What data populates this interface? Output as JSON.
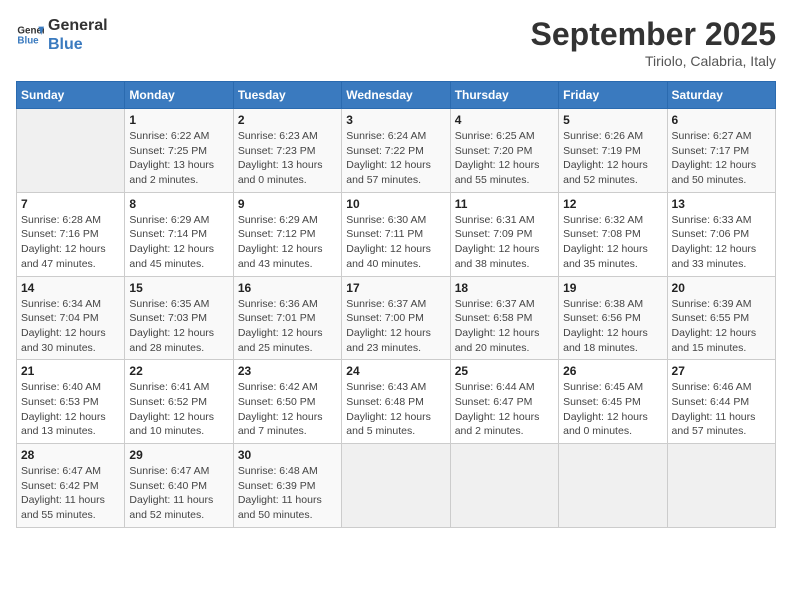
{
  "header": {
    "logo_line1": "General",
    "logo_line2": "Blue",
    "month": "September 2025",
    "location": "Tiriolo, Calabria, Italy"
  },
  "weekdays": [
    "Sunday",
    "Monday",
    "Tuesday",
    "Wednesday",
    "Thursday",
    "Friday",
    "Saturday"
  ],
  "weeks": [
    [
      {
        "num": "",
        "info": ""
      },
      {
        "num": "1",
        "info": "Sunrise: 6:22 AM\nSunset: 7:25 PM\nDaylight: 13 hours\nand 2 minutes."
      },
      {
        "num": "2",
        "info": "Sunrise: 6:23 AM\nSunset: 7:23 PM\nDaylight: 13 hours\nand 0 minutes."
      },
      {
        "num": "3",
        "info": "Sunrise: 6:24 AM\nSunset: 7:22 PM\nDaylight: 12 hours\nand 57 minutes."
      },
      {
        "num": "4",
        "info": "Sunrise: 6:25 AM\nSunset: 7:20 PM\nDaylight: 12 hours\nand 55 minutes."
      },
      {
        "num": "5",
        "info": "Sunrise: 6:26 AM\nSunset: 7:19 PM\nDaylight: 12 hours\nand 52 minutes."
      },
      {
        "num": "6",
        "info": "Sunrise: 6:27 AM\nSunset: 7:17 PM\nDaylight: 12 hours\nand 50 minutes."
      }
    ],
    [
      {
        "num": "7",
        "info": "Sunrise: 6:28 AM\nSunset: 7:16 PM\nDaylight: 12 hours\nand 47 minutes."
      },
      {
        "num": "8",
        "info": "Sunrise: 6:29 AM\nSunset: 7:14 PM\nDaylight: 12 hours\nand 45 minutes."
      },
      {
        "num": "9",
        "info": "Sunrise: 6:29 AM\nSunset: 7:12 PM\nDaylight: 12 hours\nand 43 minutes."
      },
      {
        "num": "10",
        "info": "Sunrise: 6:30 AM\nSunset: 7:11 PM\nDaylight: 12 hours\nand 40 minutes."
      },
      {
        "num": "11",
        "info": "Sunrise: 6:31 AM\nSunset: 7:09 PM\nDaylight: 12 hours\nand 38 minutes."
      },
      {
        "num": "12",
        "info": "Sunrise: 6:32 AM\nSunset: 7:08 PM\nDaylight: 12 hours\nand 35 minutes."
      },
      {
        "num": "13",
        "info": "Sunrise: 6:33 AM\nSunset: 7:06 PM\nDaylight: 12 hours\nand 33 minutes."
      }
    ],
    [
      {
        "num": "14",
        "info": "Sunrise: 6:34 AM\nSunset: 7:04 PM\nDaylight: 12 hours\nand 30 minutes."
      },
      {
        "num": "15",
        "info": "Sunrise: 6:35 AM\nSunset: 7:03 PM\nDaylight: 12 hours\nand 28 minutes."
      },
      {
        "num": "16",
        "info": "Sunrise: 6:36 AM\nSunset: 7:01 PM\nDaylight: 12 hours\nand 25 minutes."
      },
      {
        "num": "17",
        "info": "Sunrise: 6:37 AM\nSunset: 7:00 PM\nDaylight: 12 hours\nand 23 minutes."
      },
      {
        "num": "18",
        "info": "Sunrise: 6:37 AM\nSunset: 6:58 PM\nDaylight: 12 hours\nand 20 minutes."
      },
      {
        "num": "19",
        "info": "Sunrise: 6:38 AM\nSunset: 6:56 PM\nDaylight: 12 hours\nand 18 minutes."
      },
      {
        "num": "20",
        "info": "Sunrise: 6:39 AM\nSunset: 6:55 PM\nDaylight: 12 hours\nand 15 minutes."
      }
    ],
    [
      {
        "num": "21",
        "info": "Sunrise: 6:40 AM\nSunset: 6:53 PM\nDaylight: 12 hours\nand 13 minutes."
      },
      {
        "num": "22",
        "info": "Sunrise: 6:41 AM\nSunset: 6:52 PM\nDaylight: 12 hours\nand 10 minutes."
      },
      {
        "num": "23",
        "info": "Sunrise: 6:42 AM\nSunset: 6:50 PM\nDaylight: 12 hours\nand 7 minutes."
      },
      {
        "num": "24",
        "info": "Sunrise: 6:43 AM\nSunset: 6:48 PM\nDaylight: 12 hours\nand 5 minutes."
      },
      {
        "num": "25",
        "info": "Sunrise: 6:44 AM\nSunset: 6:47 PM\nDaylight: 12 hours\nand 2 minutes."
      },
      {
        "num": "26",
        "info": "Sunrise: 6:45 AM\nSunset: 6:45 PM\nDaylight: 12 hours\nand 0 minutes."
      },
      {
        "num": "27",
        "info": "Sunrise: 6:46 AM\nSunset: 6:44 PM\nDaylight: 11 hours\nand 57 minutes."
      }
    ],
    [
      {
        "num": "28",
        "info": "Sunrise: 6:47 AM\nSunset: 6:42 PM\nDaylight: 11 hours\nand 55 minutes."
      },
      {
        "num": "29",
        "info": "Sunrise: 6:47 AM\nSunset: 6:40 PM\nDaylight: 11 hours\nand 52 minutes."
      },
      {
        "num": "30",
        "info": "Sunrise: 6:48 AM\nSunset: 6:39 PM\nDaylight: 11 hours\nand 50 minutes."
      },
      {
        "num": "",
        "info": ""
      },
      {
        "num": "",
        "info": ""
      },
      {
        "num": "",
        "info": ""
      },
      {
        "num": "",
        "info": ""
      }
    ]
  ]
}
